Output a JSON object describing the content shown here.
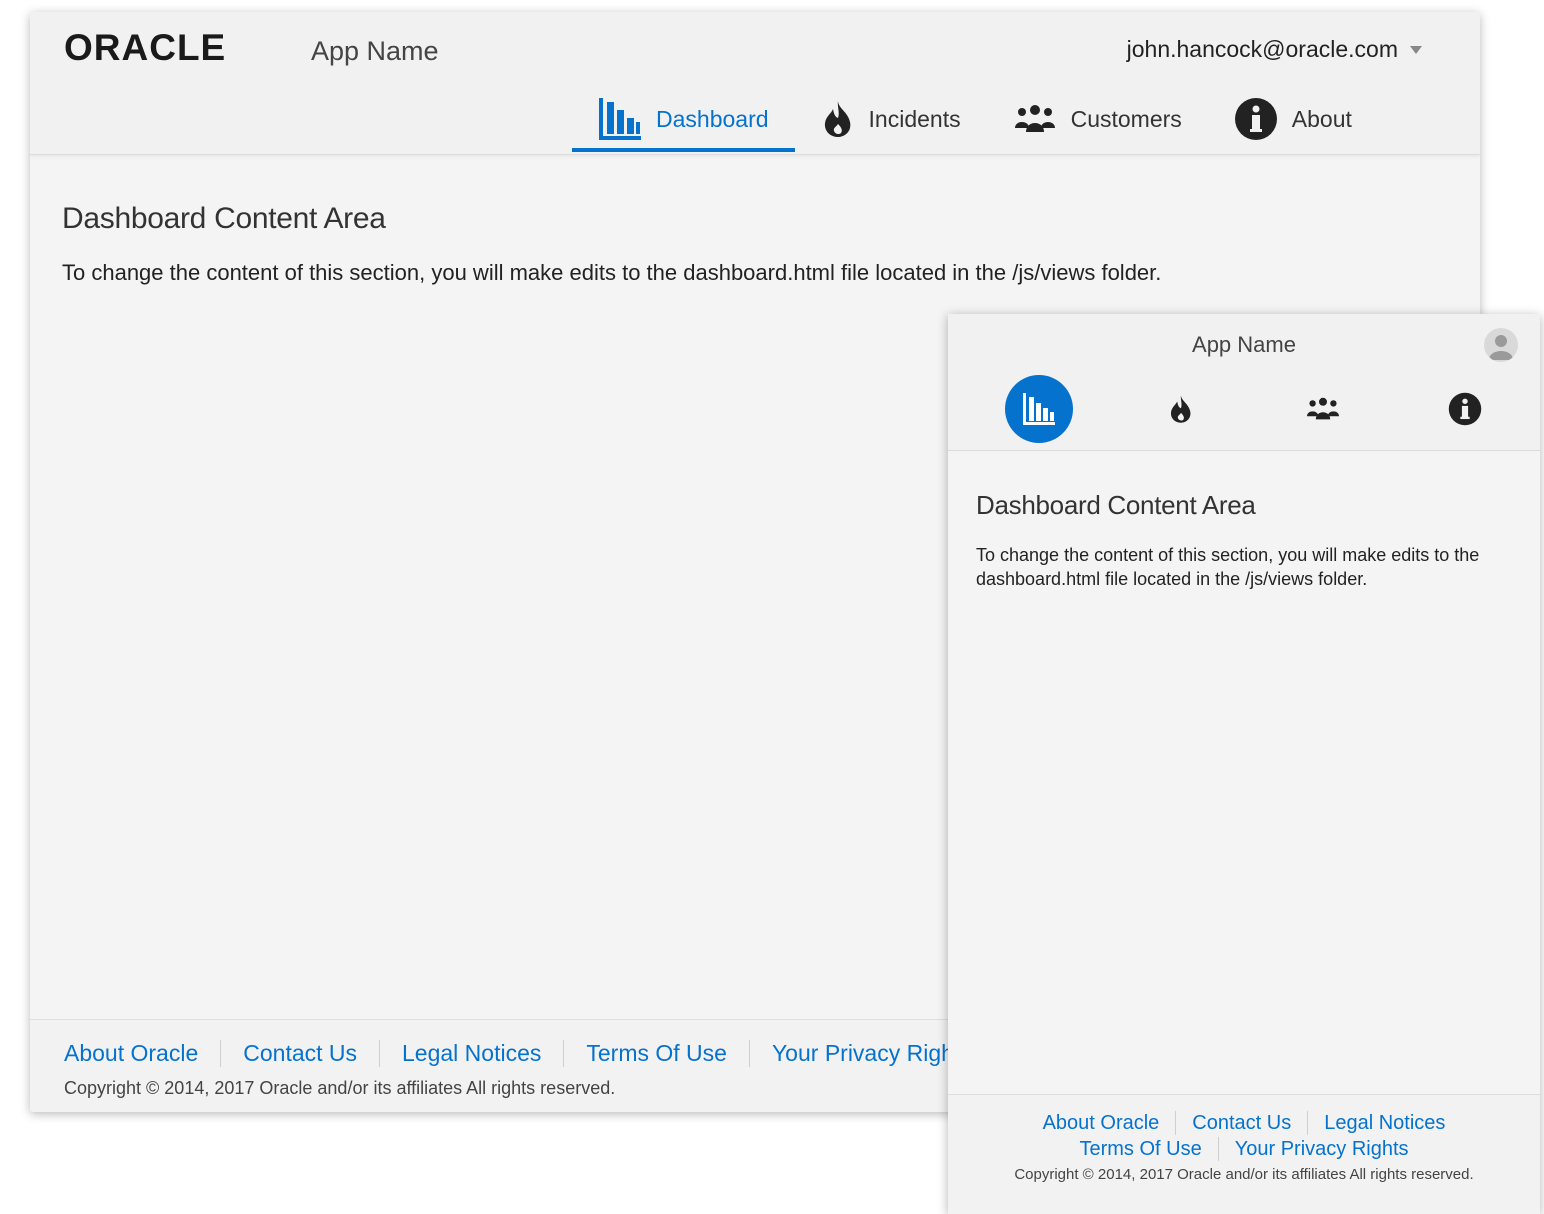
{
  "desktop": {
    "brand": "ORACLE",
    "app_name": "App Name",
    "user_email": "john.hancock@oracle.com",
    "nav": [
      {
        "label": "Dashboard",
        "icon": "bar-chart-icon",
        "active": true
      },
      {
        "label": "Incidents",
        "icon": "fire-icon",
        "active": false
      },
      {
        "label": "Customers",
        "icon": "people-icon",
        "active": false
      },
      {
        "label": "About",
        "icon": "info-icon",
        "active": false
      }
    ],
    "content": {
      "heading": "Dashboard Content Area",
      "text": "To change the content of this section, you will make edits to the dashboard.html file located in the /js/views folder."
    },
    "footer": {
      "links": [
        "About Oracle",
        "Contact Us",
        "Legal Notices",
        "Terms Of Use",
        "Your Privacy Rights"
      ],
      "copyright": "Copyright © 2014, 2017 Oracle and/or its affiliates All rights reserved."
    }
  },
  "mobile": {
    "app_name": "App Name",
    "nav_icons": [
      "bar-chart-icon",
      "fire-icon",
      "people-icon",
      "info-icon"
    ],
    "active_index": 0,
    "content": {
      "heading": "Dashboard Content Area",
      "text": "To change the content of this section, you will make edits to the dashboard.html file located in the /js/views folder."
    },
    "footer": {
      "links": [
        "About Oracle",
        "Contact Us",
        "Legal Notices",
        "Terms Of Use",
        "Your Privacy Rights"
      ],
      "copyright": "Copyright © 2014, 2017 Oracle and/or its affiliates All rights reserved."
    }
  },
  "colors": {
    "accent": "#0572ce",
    "background": "#f4f4f4",
    "header": "#f1f1f1"
  }
}
